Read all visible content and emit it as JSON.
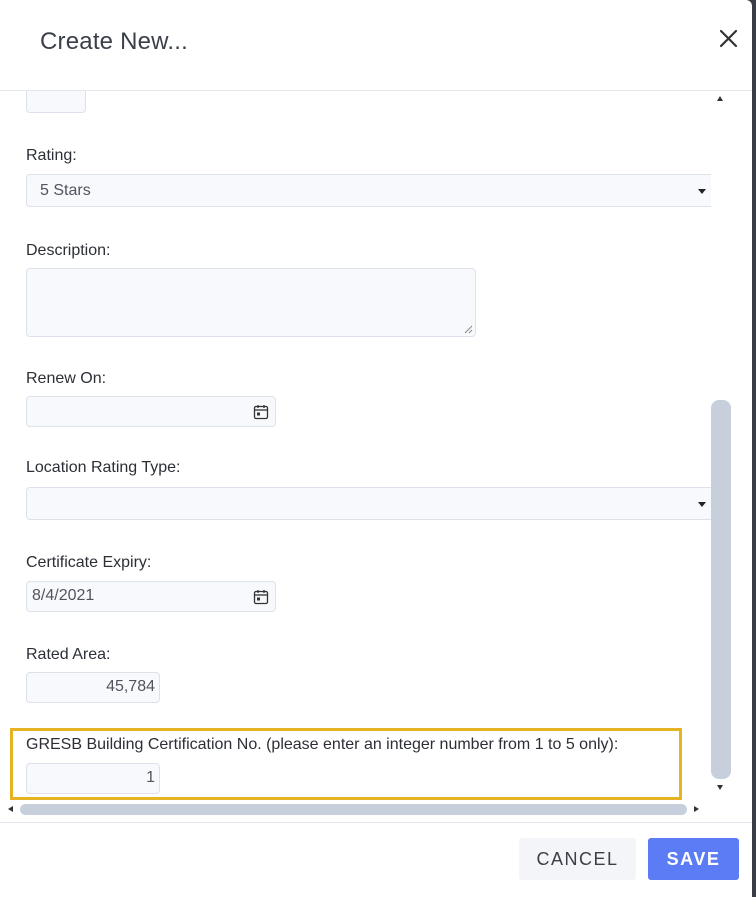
{
  "dialog": {
    "title": "Create New..."
  },
  "form": {
    "rating": {
      "label": "Rating:",
      "value": "5 Stars"
    },
    "description": {
      "label": "Description:",
      "value": ""
    },
    "renew_on": {
      "label": "Renew On:",
      "value": ""
    },
    "location_rating_type": {
      "label": "Location Rating Type:",
      "value": ""
    },
    "certificate_expiry": {
      "label": "Certificate Expiry:",
      "value": "8/4/2021"
    },
    "rated_area": {
      "label": "Rated Area:",
      "value": "45,784"
    },
    "gresb_cert_no": {
      "label": "GRESB Building Certification No. (please enter an integer number from 1 to 5 only):",
      "value": "1"
    }
  },
  "footer": {
    "cancel_label": "CANCEL",
    "save_label": "SAVE"
  },
  "colors": {
    "accent": "#5b7cf5",
    "highlight": "#e6b422"
  }
}
